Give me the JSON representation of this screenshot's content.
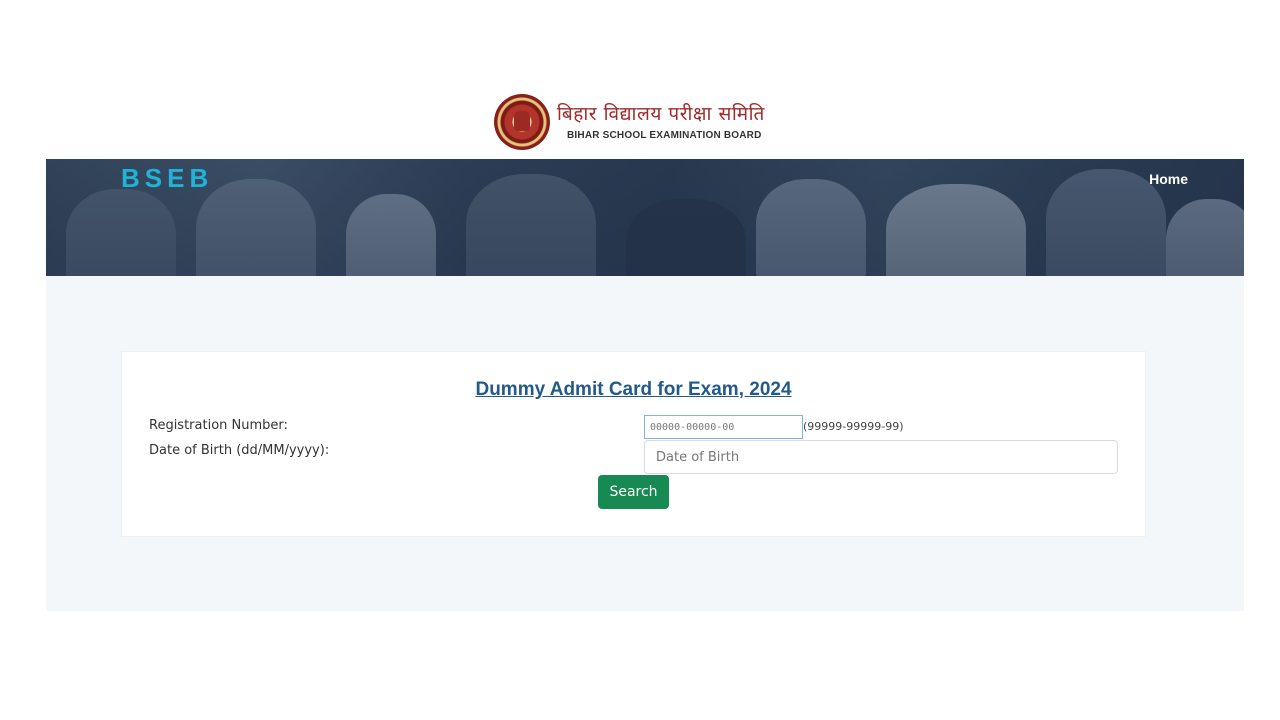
{
  "header": {
    "org_hindi": "बिहार विद्यालय परीक्षा समिति",
    "org_english": "BIHAR SCHOOL EXAMINATION BOARD"
  },
  "navbar": {
    "brand": "BSEB",
    "home_label": "Home"
  },
  "form": {
    "title": "Dummy Admit Card for Exam, 2024",
    "registration": {
      "label": "Registration Number:",
      "placeholder": "00000-00000-00",
      "format_hint": "(99999-99999-99)"
    },
    "dob": {
      "label": "Date of Birth (dd/MM/yyyy):",
      "placeholder": "Date of Birth"
    },
    "search_label": "Search"
  },
  "colors": {
    "brand_text": "#1fb3d8",
    "title_link": "#235a8a",
    "search_button": "#168a52",
    "hindi_title": "#a22a2a"
  }
}
